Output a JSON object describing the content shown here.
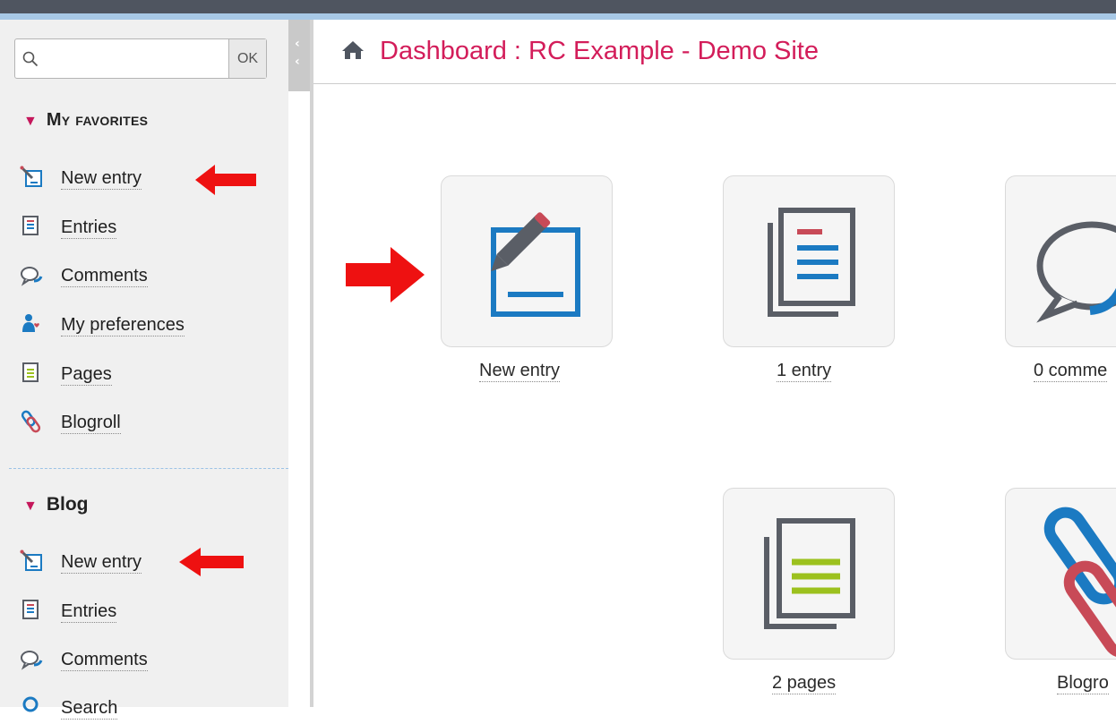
{
  "search": {
    "placeholder": "",
    "button_label": "OK"
  },
  "sidebar": {
    "favorites": {
      "title": "My favorites",
      "items": [
        {
          "label": "New entry",
          "icon": "new-entry-icon"
        },
        {
          "label": "Entries",
          "icon": "entries-icon"
        },
        {
          "label": "Comments",
          "icon": "comments-icon"
        },
        {
          "label": "My preferences",
          "icon": "preferences-icon"
        },
        {
          "label": "Pages",
          "icon": "pages-icon"
        },
        {
          "label": "Blogroll",
          "icon": "blogroll-icon"
        }
      ]
    },
    "blog": {
      "title": "Blog",
      "items": [
        {
          "label": "New entry",
          "icon": "new-entry-icon"
        },
        {
          "label": "Entries",
          "icon": "entries-icon"
        },
        {
          "label": "Comments",
          "icon": "comments-icon"
        },
        {
          "label": "Search",
          "icon": "search-icon"
        }
      ]
    }
  },
  "main": {
    "title": "Dashboard : RC Example - Demo Site",
    "tiles": [
      {
        "label": "New entry"
      },
      {
        "label": "1 entry"
      },
      {
        "label": "0 comme"
      },
      {
        "label": "2 pages"
      },
      {
        "label": "Blogro"
      }
    ]
  },
  "colors": {
    "accent": "#d31d5a",
    "blue": "#1b7ac2",
    "gray_icon": "#5a5e66",
    "red_icon": "#c84a57",
    "green_icon": "#9cc11e",
    "arrow": "#ee1111"
  }
}
